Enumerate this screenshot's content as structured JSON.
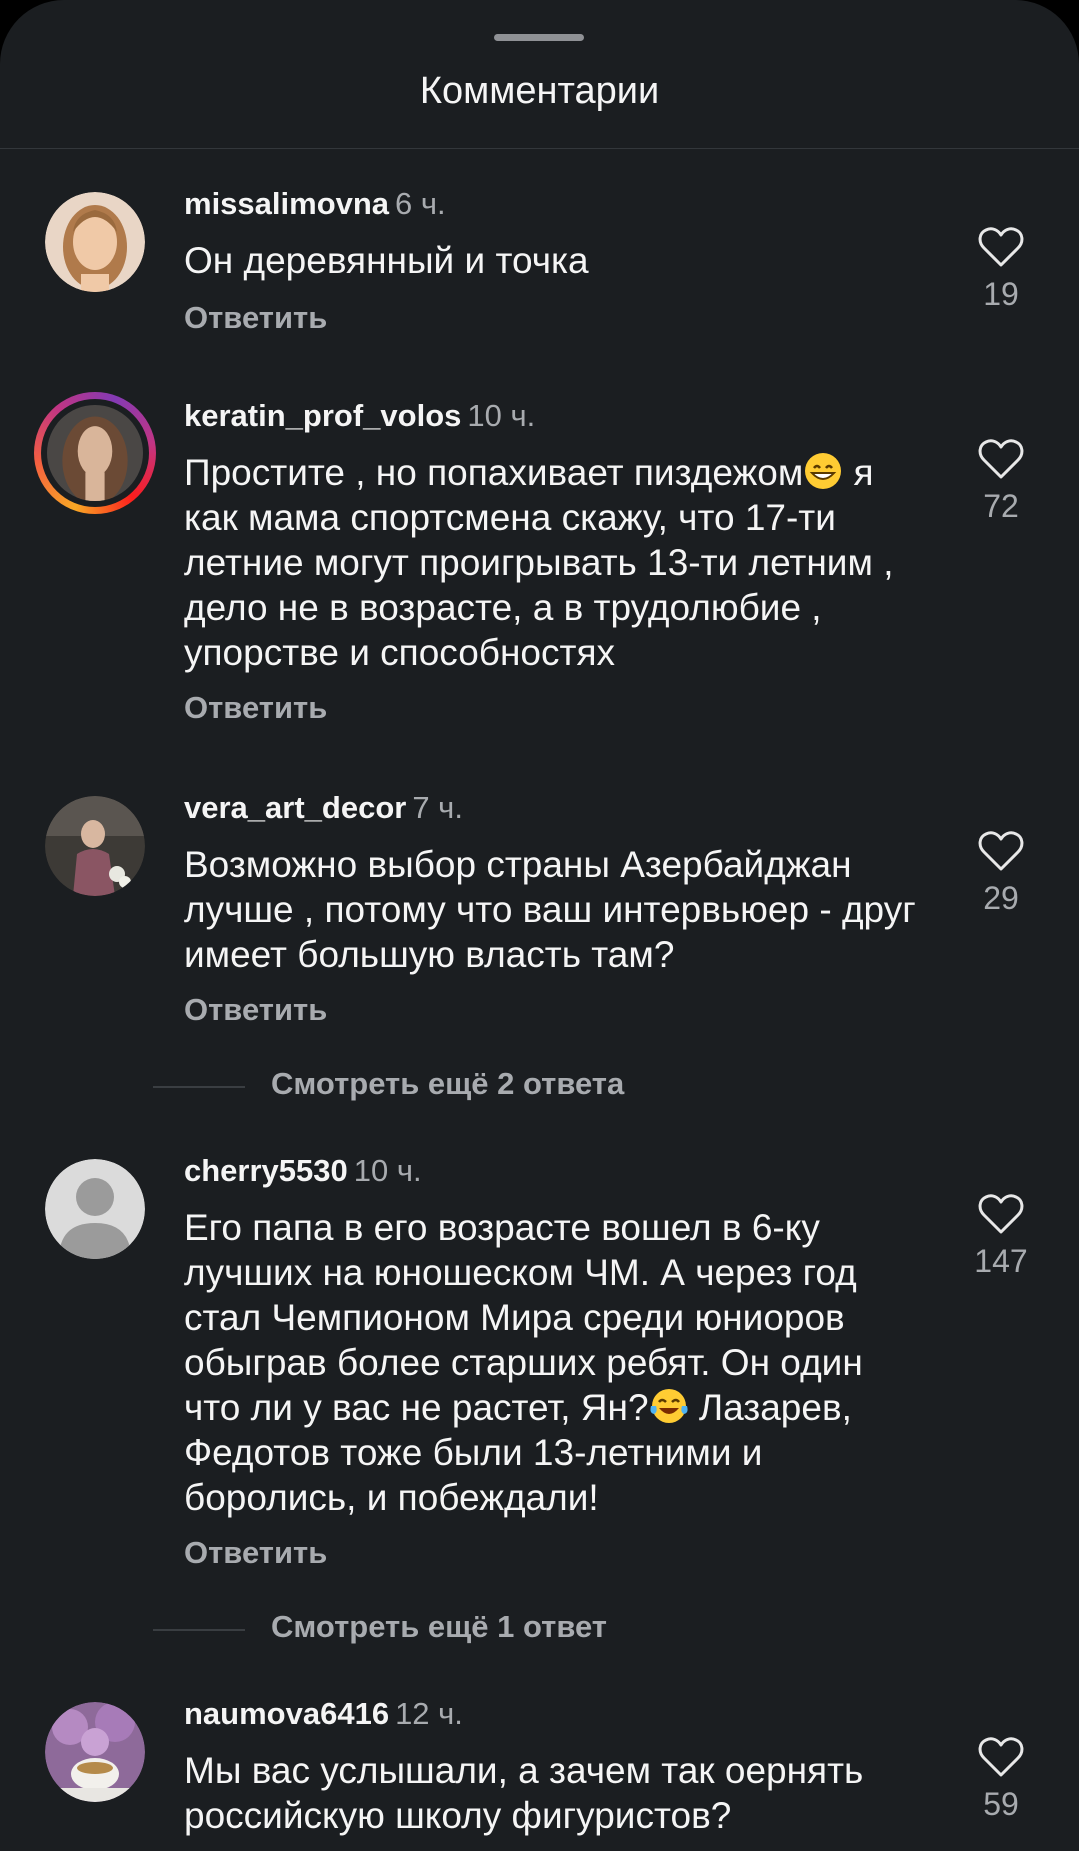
{
  "sheet": {
    "title": "Комментарии"
  },
  "comments": [
    {
      "username": "missalimovna",
      "time": "6 ч.",
      "text": "Он деревянный и точка",
      "reply_label": "Ответить",
      "likes": "19"
    },
    {
      "username": "keratin_prof_volos",
      "time": "10 ч.",
      "text_line1": "Простите , но попахивает пиздежом",
      "text_rest": " я как мама спортсмена скажу, что 17-ти летние могут проигрывать 13-ти летним , дело не в возрасте, а в трудолюбие , упорстве и способностях",
      "reply_label": "Ответить",
      "likes": "72",
      "emoji": "grinning-face-emoji"
    },
    {
      "username": "vera_art_decor",
      "time": "7 ч.",
      "text": "Возможно выбор страны Азербайджан лучше , потому что ваш интервьюер - друг имеет большую власть там?",
      "reply_label": "Ответить",
      "likes": "29",
      "more_replies": "Смотреть ещё 2 ответа"
    },
    {
      "username": "cherry5530",
      "time": "10 ч.",
      "text_part1": "Его папа в его возрасте вошел в 6-ку лучших на юношеском ЧМ. А через год стал Чемпионом Мира среди юниоров обыграв более старших ребят. Он один что ли у вас не растет, Ян?",
      "text_part2": " Лазарев, Федотов тоже были 13-летними и боролись, и побеждали!",
      "reply_label": "Ответить",
      "likes": "147",
      "emoji": "tears-of-joy-emoji",
      "more_replies": "Смотреть ещё 1 ответ"
    },
    {
      "username": "naumova6416",
      "time": "12 ч.",
      "text": "Мы вас услышали, а зачем так оернять российскую школу фигуристов?",
      "likes": "59"
    }
  ],
  "colors": {
    "background": "#1b1e21",
    "primary_text": "#f5f5f5",
    "secondary_text": "#a8abaf",
    "story_ring": [
      "#f9a825",
      "#c13584",
      "#833ab4"
    ]
  },
  "icons": {
    "like": "heart-outline-icon",
    "grabber": "drag-handle"
  }
}
